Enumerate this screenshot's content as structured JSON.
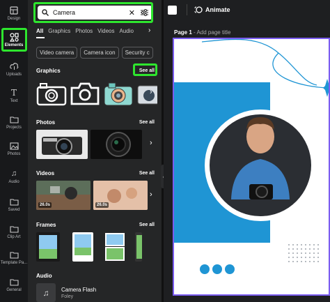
{
  "rail": {
    "items": [
      {
        "label": "Design",
        "icon": "design-icon"
      },
      {
        "label": "Elements",
        "icon": "elements-icon"
      },
      {
        "label": "Uploads",
        "icon": "upload-icon"
      },
      {
        "label": "Text",
        "icon": "text-icon"
      },
      {
        "label": "Projects",
        "icon": "folder-icon"
      },
      {
        "label": "Photos",
        "icon": "photo-icon"
      },
      {
        "label": "Audio",
        "icon": "music-icon"
      },
      {
        "label": "Saved",
        "icon": "folder-icon"
      },
      {
        "label": "Clip Art",
        "icon": "clipart-icon"
      },
      {
        "label": "Template Pa...",
        "icon": "template-icon"
      },
      {
        "label": "General",
        "icon": "folder-icon"
      }
    ]
  },
  "search": {
    "value": "Camera"
  },
  "tabs": [
    "All",
    "Graphics",
    "Photos",
    "Videos",
    "Audio"
  ],
  "chips": [
    "Video camera",
    "Camera icon",
    "Security c"
  ],
  "sections": {
    "graphics": {
      "title": "Graphics",
      "see_all": "See all"
    },
    "photos": {
      "title": "Photos",
      "see_all": "See all"
    },
    "videos": {
      "title": "Videos",
      "see_all": "See all",
      "durations": [
        "26.0s",
        "26.0s"
      ]
    },
    "frames": {
      "title": "Frames",
      "see_all": "See all"
    },
    "audio": {
      "title": "Audio",
      "track": "Camera Flash",
      "artist": "Foley"
    }
  },
  "topbar": {
    "animate": "Animate"
  },
  "page": {
    "label": "Page 1",
    "hint": " - Add page title"
  },
  "colors": {
    "highlight": "#2ee62e",
    "accent_blue": "#1f95d4",
    "selection": "#7b5cf0"
  }
}
